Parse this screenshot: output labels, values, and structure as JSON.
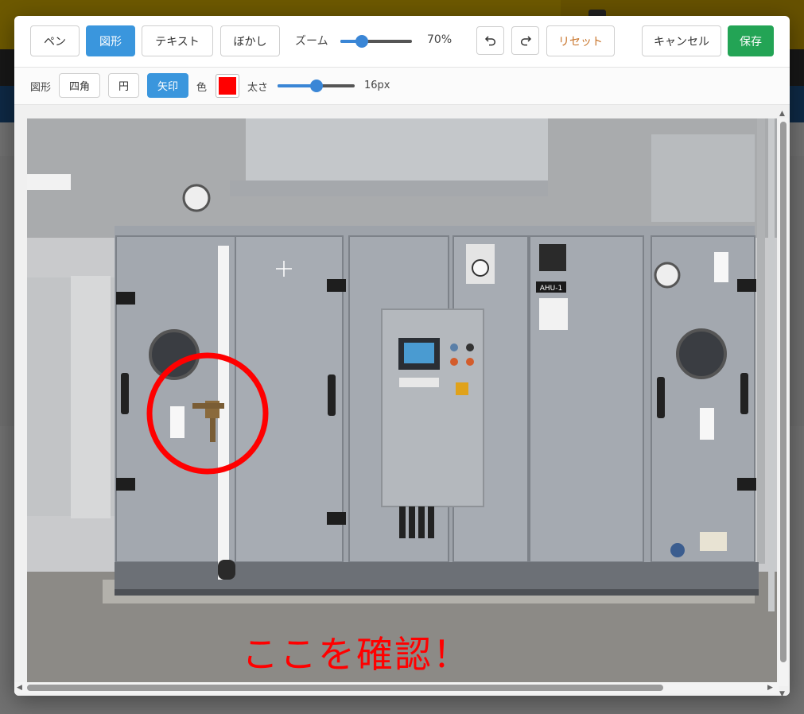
{
  "toolbar": {
    "pen_label": "ペン",
    "shape_label": "図形",
    "text_label": "テキスト",
    "blur_label": "ぼかし",
    "zoom_label": "ズーム",
    "zoom_value": "70%",
    "zoom_level": 0.3,
    "undo_icon": "undo-icon",
    "redo_icon": "redo-icon",
    "reset_label": "リセット",
    "cancel_label": "キャンセル",
    "save_label": "保存"
  },
  "shape_toolbar": {
    "shape_label": "図形",
    "rect_label": "四角",
    "circle_label": "円",
    "arrow_label": "矢印",
    "color_label": "色",
    "color_value": "#ff0000",
    "thickness_label": "太さ",
    "thickness_value": "16px",
    "thickness_level": 0.5
  },
  "canvas": {
    "annotation_text": "ここを確認！",
    "annotation_color": "#ff0000",
    "equipment_tag": "AHU-1"
  },
  "colors": {
    "primary": "#3a96dd",
    "success": "#23a455",
    "warning_text": "#c8742a"
  }
}
